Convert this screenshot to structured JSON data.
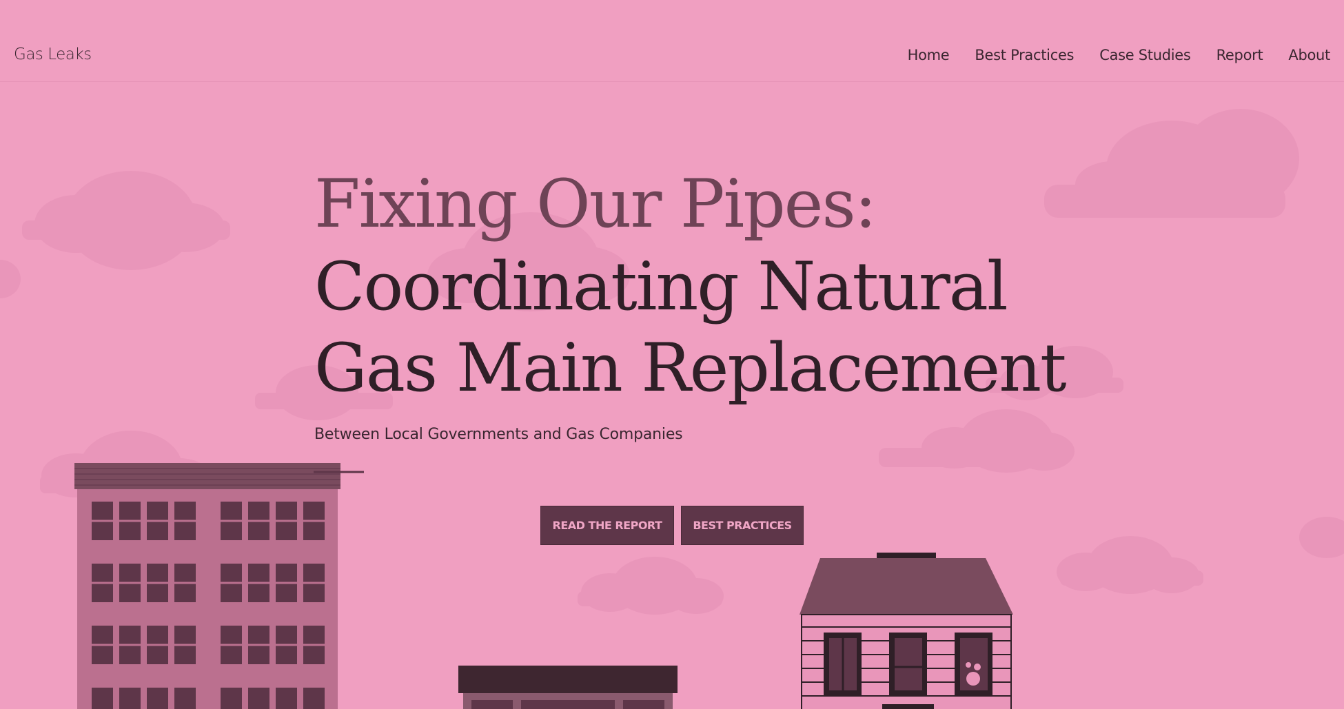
{
  "header": {
    "brand": "Gas Leaks",
    "nav": [
      {
        "label": "Home"
      },
      {
        "label": "Best Practices"
      },
      {
        "label": "Case Studies"
      },
      {
        "label": "Report"
      },
      {
        "label": "About"
      }
    ]
  },
  "hero": {
    "title_line_1": "Fixing Our Pipes:",
    "title_line_2": "Coordinating Natural",
    "title_line_3": "Gas Main Replacement",
    "subtitle": "Between Local Governments and Gas Companies"
  },
  "buttons": {
    "read_report": "READ THE REPORT",
    "best_practices": "BEST PRACTICES"
  },
  "colors": {
    "background": "#f09fc1",
    "title_accent": "#6e4356",
    "title_dark": "#2f1f27",
    "button_bg": "#5e3649",
    "button_text": "#f0a6c6"
  }
}
